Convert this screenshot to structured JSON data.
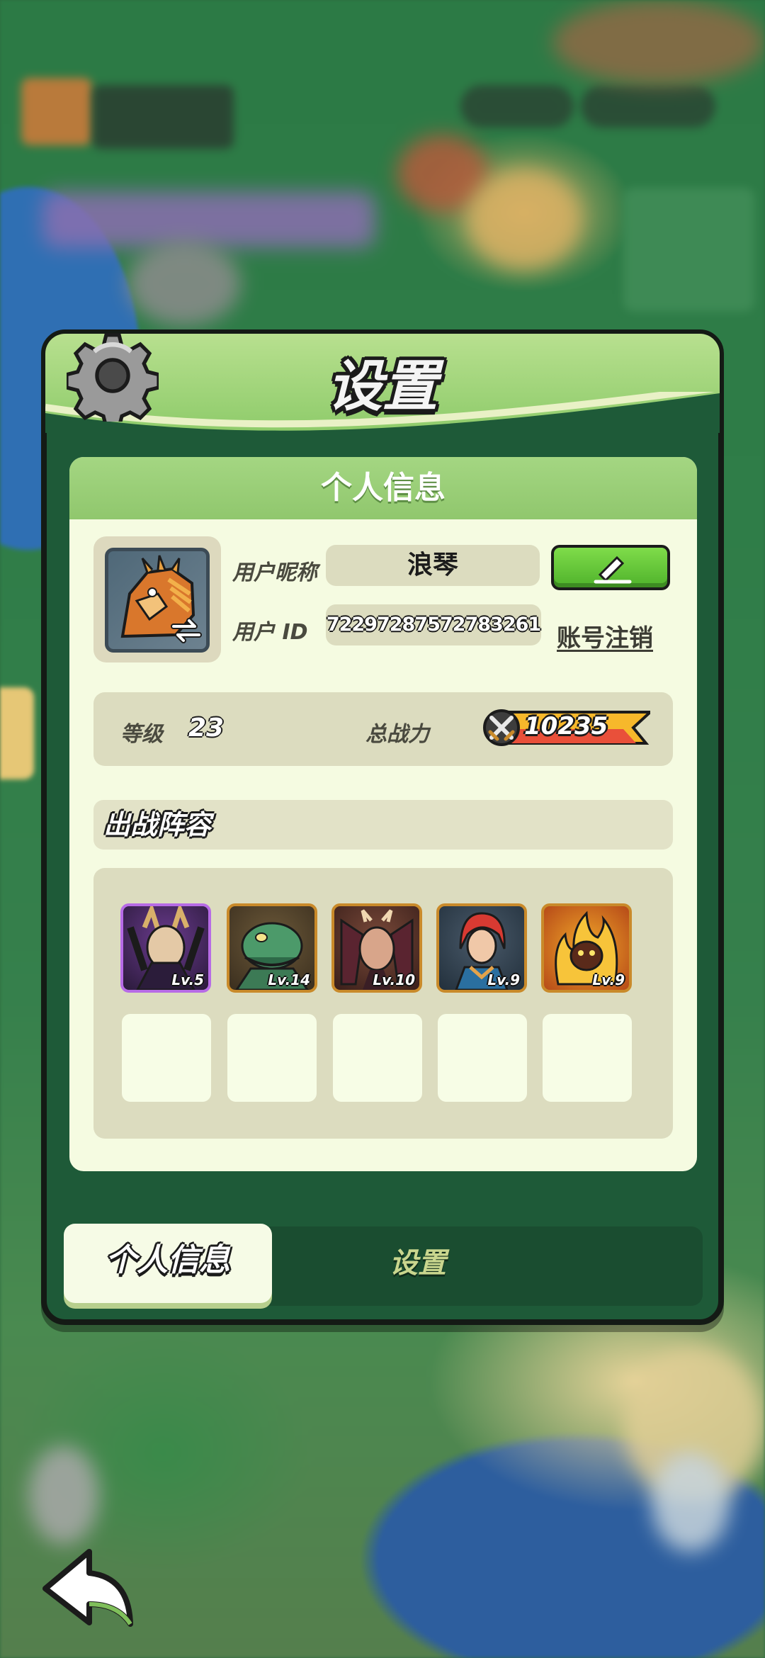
{
  "panel": {
    "title": "设置",
    "icon": "gear-icon"
  },
  "card": {
    "title": "个人信息"
  },
  "profile": {
    "avatar_icon": "dragon-avatar-icon",
    "nickname_label": "用户昵称",
    "nickname": "浪琴",
    "id_label": "用户 ID",
    "user_id": "72297287572783261",
    "edit_icon": "pencil-icon",
    "logout_label": "账号注销"
  },
  "stats": {
    "level_label": "等级",
    "level": "23",
    "power_label": "总战力",
    "power": "10235",
    "power_icon": "crossed-swords-icon"
  },
  "lineup": {
    "title": "出战阵容",
    "heroes": [
      {
        "level": "Lv.5",
        "rarity_color": "#b76be6"
      },
      {
        "level": "Lv.14",
        "rarity_color": "#c98a2a"
      },
      {
        "level": "Lv.10",
        "rarity_color": "#c98a2a"
      },
      {
        "level": "Lv.9",
        "rarity_color": "#c98a2a"
      },
      {
        "level": "Lv.9",
        "rarity_color": "#c98a2a"
      }
    ],
    "empty_slots": 5
  },
  "tabs": [
    {
      "label": "个人信息",
      "active": true
    },
    {
      "label": "设置",
      "active": false
    }
  ],
  "nav": {
    "back_icon": "back-arrow-icon"
  },
  "colors": {
    "accent_green": "#8ecb6a",
    "panel_dark": "#1e5a38",
    "card_bg": "#f5fbe1",
    "button_green": "#4fb22b"
  }
}
